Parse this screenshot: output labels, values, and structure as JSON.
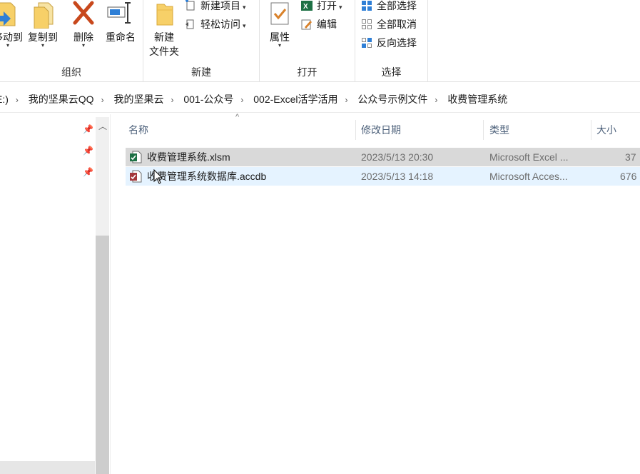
{
  "ribbon": {
    "organize": {
      "label": "组织",
      "move_to": "移动到",
      "copy_to": "复制到",
      "delete": "删除",
      "rename": "重命名"
    },
    "new": {
      "label": "新建",
      "new_folder_line1": "新建",
      "new_folder_line2": "文件夹",
      "new_item": "新建项目",
      "easy_access": "轻松访问"
    },
    "open": {
      "label": "打开",
      "properties": "属性",
      "open": "打开",
      "edit": "编辑"
    },
    "select": {
      "label": "选择",
      "select_all": "全部选择",
      "select_none": "全部取消",
      "invert": "反向选择"
    }
  },
  "address": {
    "crumbs": [
      "E:)",
      "我的坚果云QQ",
      "我的坚果云",
      "001-公众号",
      "002-Excel活学活用",
      "公众号示例文件",
      "收费管理系统"
    ]
  },
  "columns": {
    "name": "名称",
    "modified": "修改日期",
    "type": "类型",
    "size": "大小"
  },
  "files": [
    {
      "name": "收费管理系统.xlsm",
      "modified": "2023/5/13 20:30",
      "type": "Microsoft Excel ...",
      "size": "37",
      "icon": "excel-macro-file-icon"
    },
    {
      "name": "收费管理系统数据库.accdb",
      "modified": "2023/5/13 14:18",
      "type": "Microsoft Acces...",
      "size": "676",
      "icon": "access-database-file-icon"
    }
  ],
  "colors": {
    "selected_row": "#d9d9d9",
    "hover_row": "#e5f3ff",
    "header_text": "#4c607a",
    "excel_green": "#1e7145",
    "access_red": "#a4373a",
    "folder_yellow": "#f7d068"
  }
}
